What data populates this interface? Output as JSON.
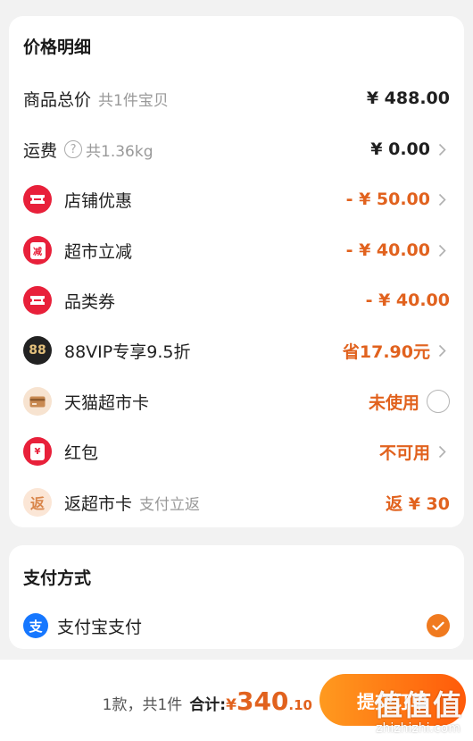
{
  "price_detail": {
    "title": "价格明细",
    "rows": [
      {
        "label": "商品总价",
        "sub": "共1件宝贝",
        "value": "¥ 488.00"
      },
      {
        "label": "运费",
        "help": "?",
        "sub": "共1.36kg",
        "value": "¥ 0.00"
      },
      {
        "label": "店铺优惠",
        "value": "- ¥ 50.00"
      },
      {
        "label": "超市立减",
        "icon_text": "减",
        "value": "- ¥ 40.00"
      },
      {
        "label": "品类券",
        "value": "- ¥ 40.00"
      },
      {
        "label": "88VIP专享9.5折",
        "icon_text": "88",
        "value": "省17.90元"
      },
      {
        "label": "天猫超市卡",
        "value": "未使用"
      },
      {
        "label": "红包",
        "icon_text": "¥",
        "value": "不可用"
      },
      {
        "label": "返超市卡",
        "icon_text": "返",
        "sub": "支付立返",
        "value": "返 ¥ 30"
      }
    ]
  },
  "payment": {
    "title": "支付方式",
    "method_icon": "支",
    "method_label": "支付宝支付"
  },
  "bottom": {
    "count": "1款，共1件",
    "total_label": "合计:",
    "currency": "¥",
    "amount_int": "340",
    "amount_dec": ".10",
    "submit_label": "提交订单"
  },
  "watermark": {
    "logo": "值值值",
    "url": "zhizhizhi.com"
  },
  "colors": {
    "accent_orange": "#e1621e",
    "coupon_red": "#e8203a",
    "vip_black": "#222222",
    "alipay_blue": "#1677ff",
    "button_gradient_start": "#ff9a1f",
    "button_gradient_end": "#ff5a0a"
  },
  "icons": {
    "chevron": "chevron-right-icon",
    "shop_coupon": "ticket-icon",
    "market_cut": "discount-badge-icon",
    "category_coupon": "ticket-icon",
    "vip": "88vip-badge-icon",
    "market_card": "card-icon",
    "red_packet": "red-packet-icon",
    "rebate": "rebate-icon",
    "alipay": "alipay-icon",
    "selected": "check-circle-icon"
  }
}
